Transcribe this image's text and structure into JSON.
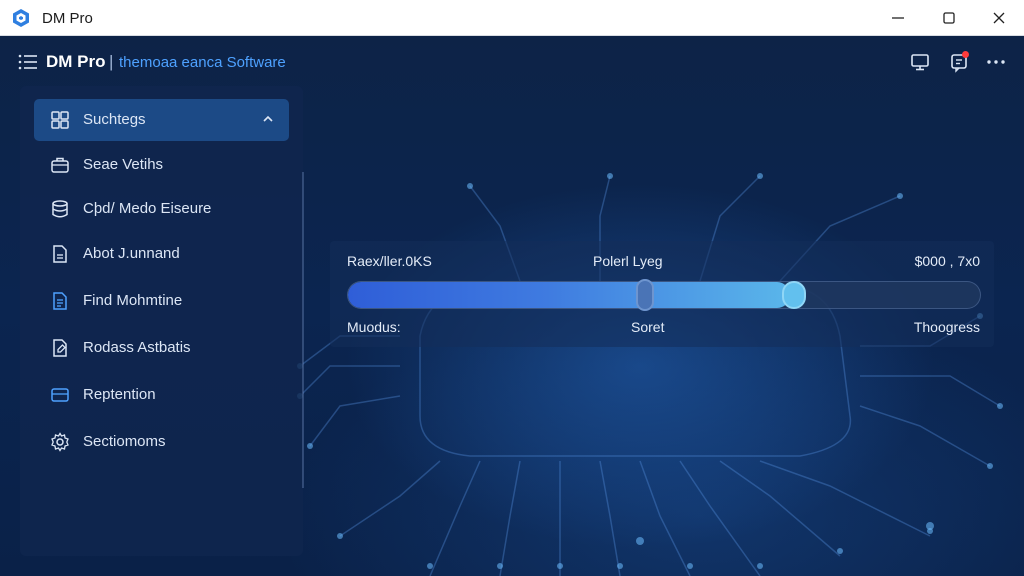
{
  "window": {
    "title": "DM Pro",
    "icons": {
      "logo": "app-logo-icon",
      "minimize": "minimize-icon",
      "maximize": "maximize-icon",
      "close": "close-icon"
    }
  },
  "appbar": {
    "title": "DM Pro",
    "separator": "|",
    "subtitle": "themoaa eanca Software",
    "icons": {
      "menu": "hamburger-menu-icon",
      "monitor": "monitor-icon",
      "notifications": "notification-icon",
      "more": "more-icon"
    }
  },
  "sidebar": {
    "items": [
      {
        "label": "Suchtegs",
        "icon": "dashboard-grid-icon",
        "active": true
      },
      {
        "label": "Seae Vetihs",
        "icon": "briefcase-icon"
      },
      {
        "label": "Cþd/ Medo Eiseure",
        "icon": "database-icon"
      },
      {
        "label": "Abot J.unnand",
        "icon": "document-icon"
      },
      {
        "label": "Find Mohmtine",
        "icon": "file-text-icon"
      },
      {
        "label": "Rodass Astbatis",
        "icon": "edit-file-icon"
      },
      {
        "label": "Reptention",
        "icon": "storage-icon"
      },
      {
        "label": "Sectiomoms",
        "icon": "gear-icon"
      }
    ]
  },
  "progress": {
    "top_left": "Raex/ller.0KS",
    "top_mid": "Polerl Lyeg",
    "top_right": "$000 , 7x0",
    "bottom_left": "Muodus:",
    "bottom_mid": "Soret",
    "bottom_right": "Thoogress",
    "value_percent": 70,
    "mid_marker_percent": 47
  },
  "colors": {
    "accent": "#4ea1ff",
    "active_item": "#1c4a86",
    "notify": "#ff3b3b"
  }
}
